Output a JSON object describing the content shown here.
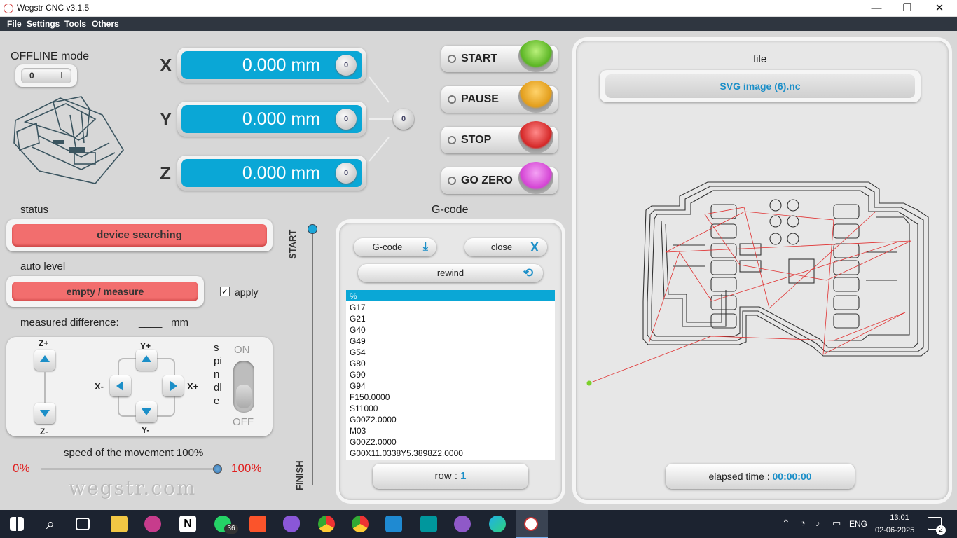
{
  "window": {
    "title": "Wegstr CNC  v3.1.5",
    "minimize": "—",
    "maximize": "❐",
    "close": "✕"
  },
  "menu": [
    "File",
    "Settings",
    "Tools",
    "Others"
  ],
  "offline": {
    "label": "OFFLINE mode",
    "off": "0",
    "on": "I"
  },
  "axes": [
    {
      "name": "X",
      "value": "0.000 mm"
    },
    {
      "name": "Y",
      "value": "0.000 mm"
    },
    {
      "name": "Z",
      "value": "0.000 mm"
    }
  ],
  "zero_glyph": "0",
  "controls": {
    "start": "START",
    "pause": "PAUSE",
    "stop": "STOP",
    "go_zero": "GO ZERO"
  },
  "status": {
    "label": "status",
    "value": "device searching"
  },
  "auto_level": {
    "label": "auto level",
    "value": "empty / measure",
    "apply": "apply",
    "apply_checked": true
  },
  "measured": {
    "label": "measured difference:",
    "value": "____",
    "unit": "mm"
  },
  "jog": {
    "z_plus": "Z+",
    "z_minus": "Z-",
    "y_plus": "Y+",
    "y_minus": "Y-",
    "x_minus": "X-",
    "x_plus": "X+",
    "spindle": "spindle",
    "on": "ON",
    "off": "OFF"
  },
  "speed": {
    "label": "speed of the movement 100%",
    "min": "0%",
    "max": "100%",
    "value": 1.0
  },
  "watermark": "wegstr.com",
  "progress": {
    "start": "START",
    "finish": "FINISH"
  },
  "gcode": {
    "title": "G-code",
    "load": "G-code",
    "close": "close",
    "rewind": "rewind",
    "lines": [
      "%",
      "G17",
      "G21",
      "G40",
      "G49",
      "G54",
      "G80",
      "G90",
      "G94",
      "F150.0000",
      "S11000",
      "G00Z2.0000",
      "M03",
      "G00Z2.0000",
      "G00X11.0338Y5.3898Z2.0000"
    ],
    "row_label": "row :",
    "row_value": "1"
  },
  "file": {
    "label": "file",
    "name": "SVG image (6).nc",
    "elapsed_label": "elapsed time :",
    "elapsed_value": "00:00:00"
  },
  "taskbar": {
    "whatsapp_badge": "36",
    "lang": "ENG",
    "time": "13:01",
    "date": "02-06-2025",
    "notif": "2"
  },
  "colors": {
    "cyan": "#0aa7d6",
    "red_bar": "#f26e6e",
    "start": "#6cc531",
    "pause": "#e7a72a",
    "stop": "#d93232",
    "gozero": "#d94ed9"
  }
}
